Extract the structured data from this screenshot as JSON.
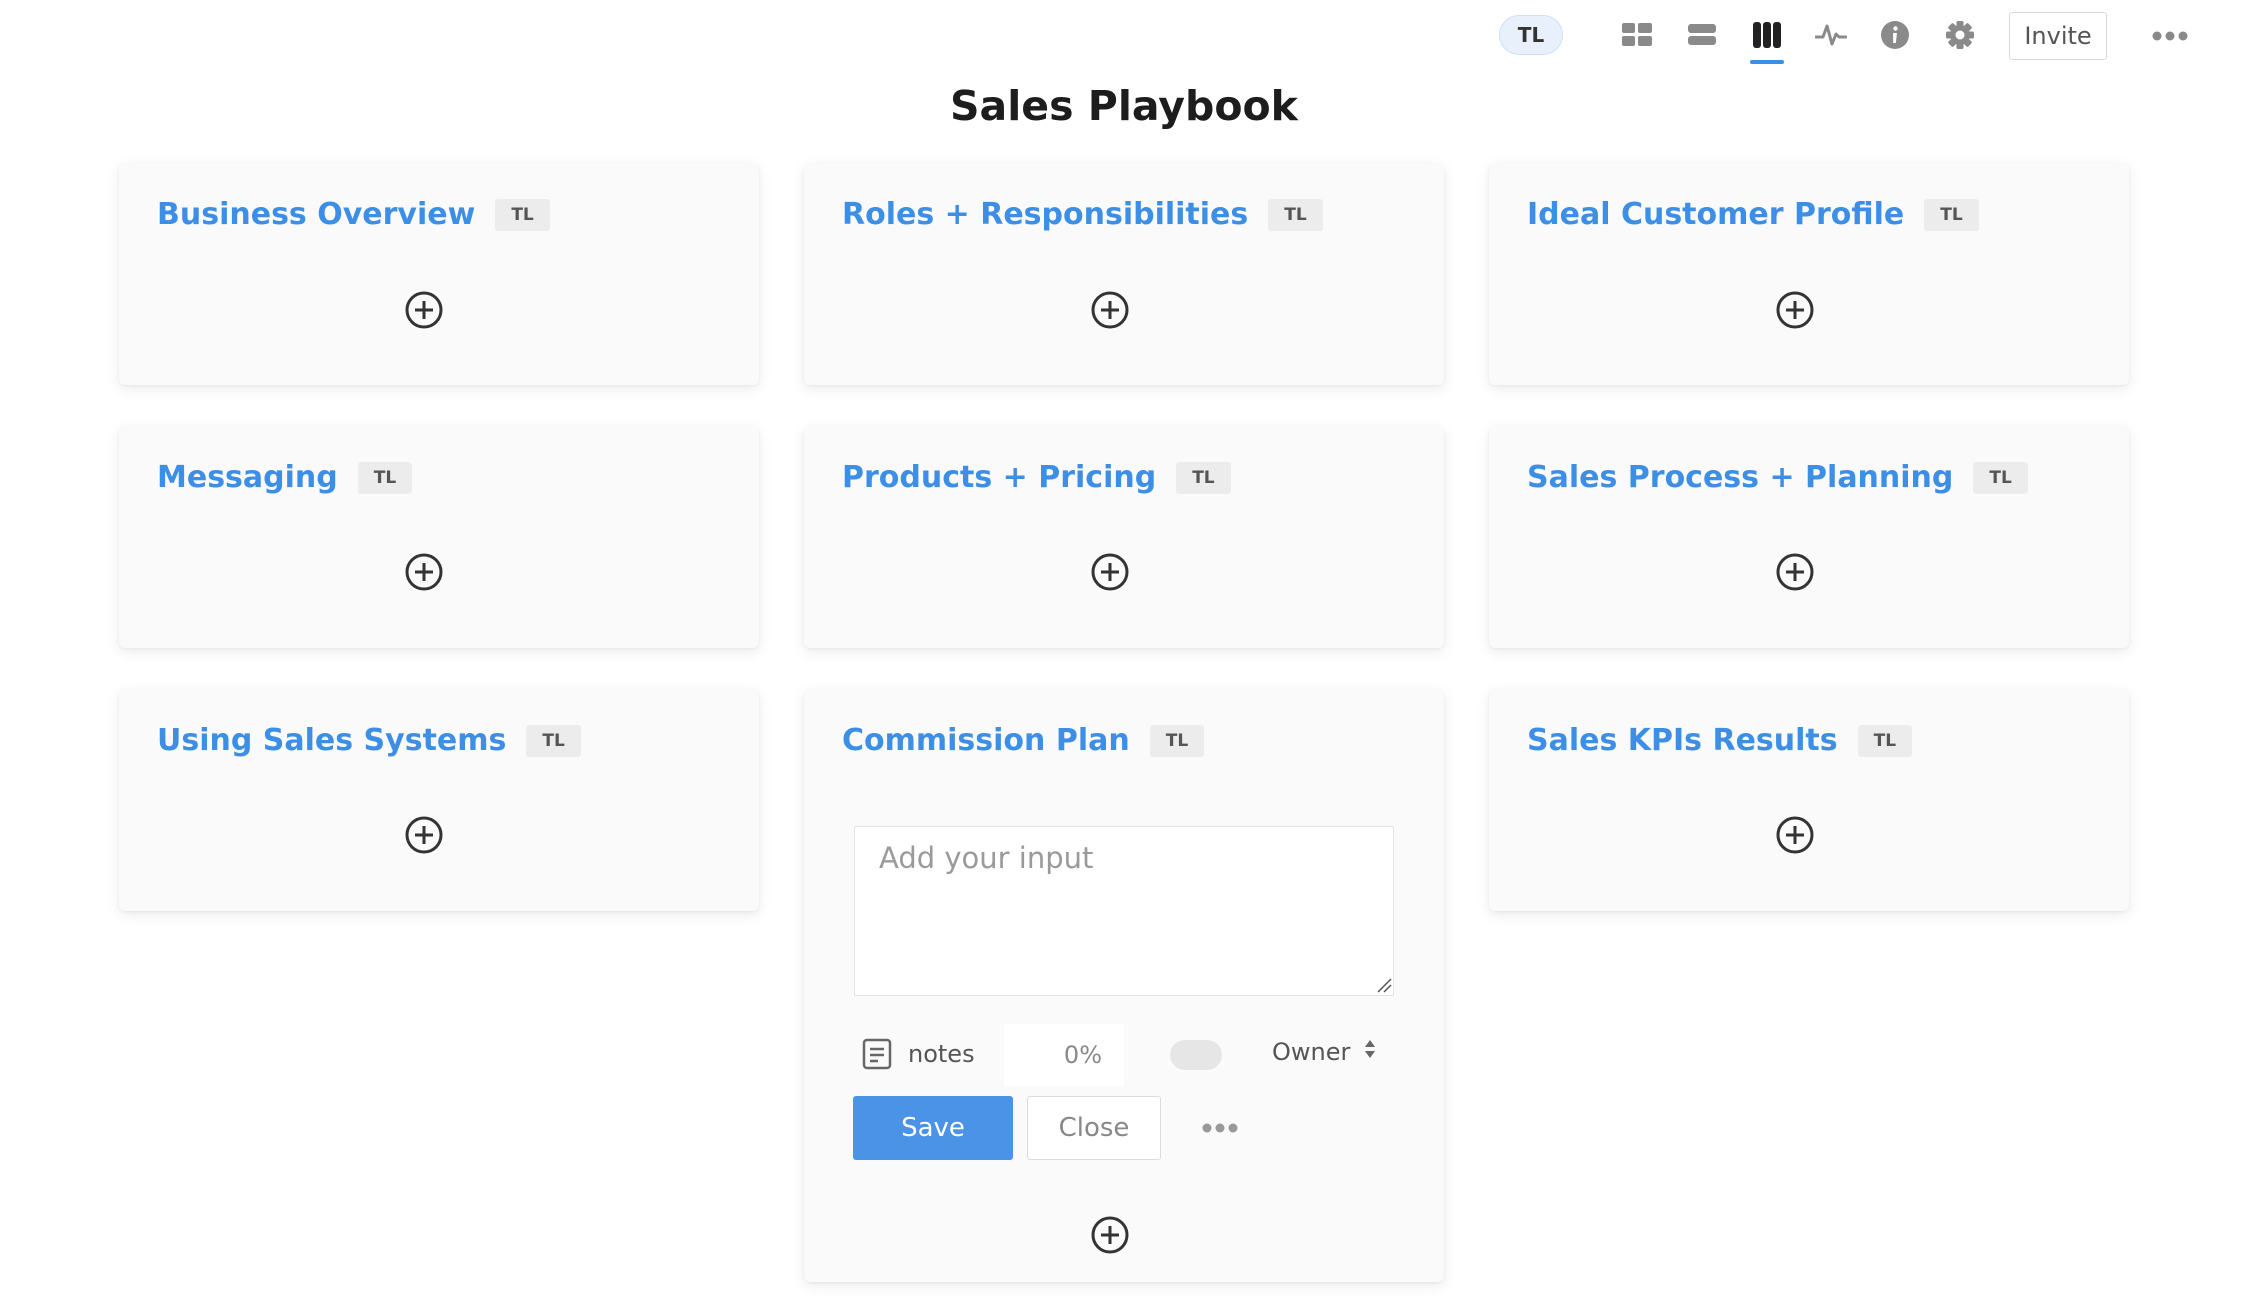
{
  "header": {
    "user_initials": "TL",
    "invite_label": "Invite",
    "toolbar_icons": [
      "grid-view-icon",
      "list-view-icon",
      "board-view-icon",
      "activity-icon",
      "info-icon",
      "gear-icon",
      "more-icon"
    ],
    "active_view": "board-view-icon",
    "accent_color": "#3d8fe6"
  },
  "page": {
    "title": "Sales Playbook"
  },
  "cards": [
    {
      "title": "Business Overview",
      "badge": "TL"
    },
    {
      "title": "Roles + Responsibilities",
      "badge": "TL"
    },
    {
      "title": "Ideal Customer Profile",
      "badge": "TL"
    },
    {
      "title": "Messaging",
      "badge": "TL"
    },
    {
      "title": "Products + Pricing",
      "badge": "TL"
    },
    {
      "title": "Sales Process + Planning",
      "badge": "TL"
    },
    {
      "title": "Using Sales Systems",
      "badge": "TL"
    },
    {
      "title": "Commission Plan",
      "badge": "TL"
    },
    {
      "title": "Sales KPIs Results",
      "badge": "TL"
    }
  ],
  "editor": {
    "input_placeholder": "Add your input",
    "input_value": "",
    "notes_label": "notes",
    "percent_value": "0%",
    "owner_label": "Owner",
    "save_label": "Save",
    "close_label": "Close"
  }
}
